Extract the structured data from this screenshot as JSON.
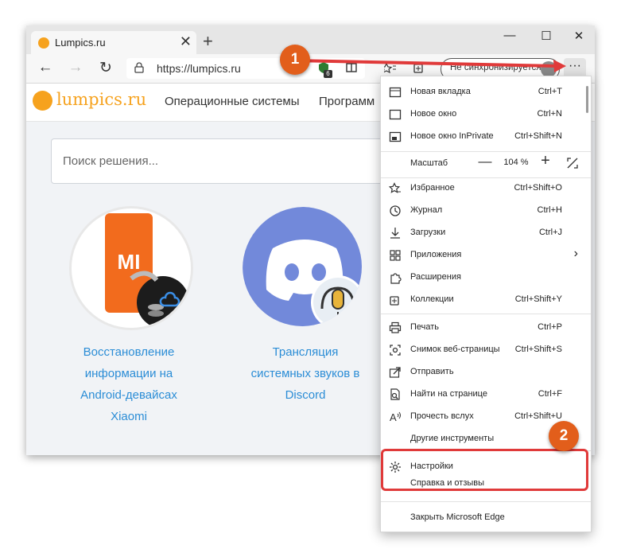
{
  "browser": {
    "tab": {
      "title": "Lumpics.ru",
      "close": "✕"
    },
    "new_tab": "+",
    "window_controls": {
      "minimize": "—",
      "maximize": "☐",
      "close": "✕"
    },
    "nav": {
      "back": "←",
      "forward": "→",
      "refresh": "↻"
    },
    "address": {
      "url": "https://lumpics.ru"
    },
    "extension_badge": "6",
    "sync_button": "Не синхронизируется",
    "more_button": "···"
  },
  "site": {
    "logo": "lumpics.ru",
    "nav": [
      "Операционные системы",
      "Программ"
    ],
    "search_placeholder": "Поиск решения...",
    "cards": [
      {
        "lines": [
          "Восстановление",
          "информации на",
          "Android-девайсах",
          "Xiaomi"
        ],
        "logo": "MI"
      },
      {
        "lines": [
          "Трансляция",
          "системных звуков в",
          "Discord"
        ]
      }
    ]
  },
  "menu": {
    "items": [
      {
        "label": "Новая вкладка",
        "shortcut": "Ctrl+T",
        "icon": "new-tab-icon"
      },
      {
        "label": "Новое окно",
        "shortcut": "Ctrl+N",
        "icon": "new-window-icon"
      },
      {
        "label": "Новое окно InPrivate",
        "shortcut": "Ctrl+Shift+N",
        "icon": "inprivate-icon"
      },
      {
        "label": "Избранное",
        "shortcut": "Ctrl+Shift+O",
        "icon": "favorites-icon"
      },
      {
        "label": "Журнал",
        "shortcut": "Ctrl+H",
        "icon": "history-icon"
      },
      {
        "label": "Загрузки",
        "shortcut": "Ctrl+J",
        "icon": "download-icon"
      },
      {
        "label": "Приложения",
        "shortcut": "",
        "icon": "apps-icon"
      },
      {
        "label": "Расширения",
        "shortcut": "",
        "icon": "extensions-icon"
      },
      {
        "label": "Коллекции",
        "shortcut": "Ctrl+Shift+Y",
        "icon": "collections-icon"
      },
      {
        "label": "Печать",
        "shortcut": "Ctrl+P",
        "icon": "print-icon"
      },
      {
        "label": "Снимок веб-страницы",
        "shortcut": "Ctrl+Shift+S",
        "icon": "screenshot-icon"
      },
      {
        "label": "Отправить",
        "shortcut": "",
        "icon": "share-icon"
      },
      {
        "label": "Найти на странице",
        "shortcut": "Ctrl+F",
        "icon": "find-icon"
      },
      {
        "label": "Прочесть вслух",
        "shortcut": "Ctrl+Shift+U",
        "icon": "read-aloud-icon"
      },
      {
        "label": "Другие инструменты",
        "shortcut": "",
        "icon": ""
      },
      {
        "label": "Настройки",
        "shortcut": "",
        "icon": "gear-icon"
      },
      {
        "label": "Справка и отзывы",
        "shortcut": "",
        "icon": ""
      },
      {
        "label": "Закрыть Microsoft Edge",
        "shortcut": "",
        "icon": ""
      }
    ],
    "zoom": {
      "label": "Масштаб",
      "minus": "—",
      "value": "104 %",
      "plus": "+"
    },
    "submenu_arrow": "›"
  },
  "annotations": {
    "step1": "1",
    "step2": "2"
  },
  "colors": {
    "accent_orange": "#f6a21e",
    "link_blue": "#2b8dd6",
    "badge": "#e25e1b",
    "highlight": "#e03a3a"
  }
}
